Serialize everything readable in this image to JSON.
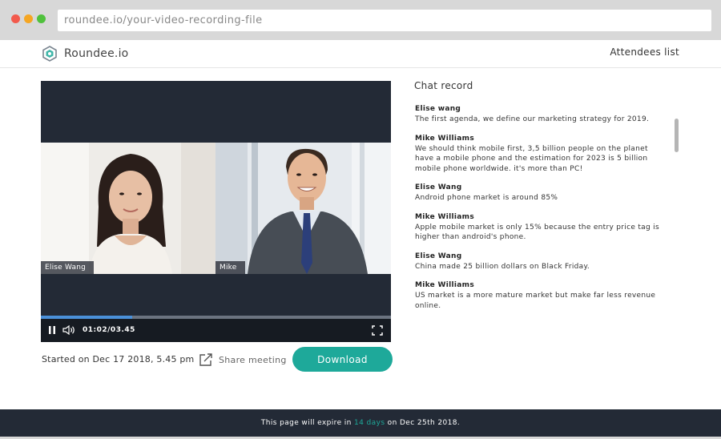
{
  "browser": {
    "url": "roundee.io/your-video-recording-file",
    "controls": [
      "close",
      "minimize",
      "maximize"
    ]
  },
  "header": {
    "logo_text": "Roundee.io",
    "attendees_link": "Attendees list"
  },
  "player": {
    "participants": [
      {
        "name": "Elise Wang"
      },
      {
        "name": "Mike"
      }
    ],
    "time": "01:02/03.45",
    "progress": 0.26,
    "icons": [
      "pause-icon",
      "volume-icon",
      "fullscreen-icon"
    ]
  },
  "meeting": {
    "started": "Started on Dec 17 2018, 5.45 pm",
    "share_label": "Share meeting",
    "download_label": "Download"
  },
  "chat": {
    "title": "Chat record",
    "messages": [
      {
        "author": "Elise wang",
        "text": "The first agenda, we define our marketing strategy for 2019."
      },
      {
        "author": "Mike Williams",
        "text": "We should think mobile first, 3,5 billion people on the planet have a mobile phone and the estimation for 2023 is 5 billion mobile phone worldwide. it's more than PC!"
      },
      {
        "author": "Elise Wang",
        "text": "Android phone market is around 85%"
      },
      {
        "author": "Mike Williams",
        "text": "Apple mobile market is only 15% because the entry price tag is higher than android's phone."
      },
      {
        "author": "Elise Wang",
        "text": "China made 25 billion dollars on Black Friday."
      },
      {
        "author": "Mike Williams",
        "text": "US market is a more mature market but make far less revenue online."
      }
    ]
  },
  "footer": {
    "prefix": "This page will expire in ",
    "highlight": "14 days",
    "suffix": " on Dec 25th 2018."
  },
  "colors": {
    "accent": "#1ea99a",
    "dark": "#232a36",
    "progress": "#4a90d9"
  }
}
